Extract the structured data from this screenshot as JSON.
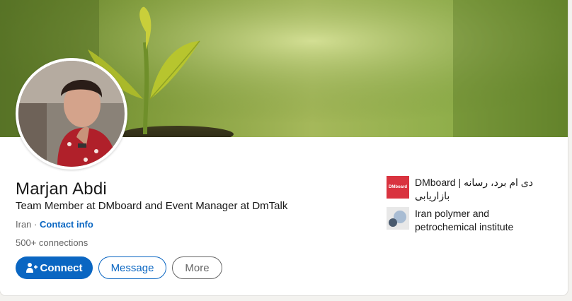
{
  "profile": {
    "name": "Marjan Abdi",
    "headline": "Team Member at DMboard and Event Manager at DmTalk",
    "location": "Iran",
    "separator": "·",
    "contact_info": "Contact info",
    "connections": "500+ connections"
  },
  "actions": {
    "connect": "Connect",
    "message": "Message",
    "more": "More"
  },
  "organizations": [
    {
      "name_line1": "DMboard | دی ام برد، رسانه",
      "name_line2": "بازاریابی",
      "logo_text": "DMboard",
      "logo_color": "#d9333f"
    },
    {
      "name": "Iran polymer and petrochemical institute",
      "logo_color": "#e8e8e8"
    }
  ],
  "colors": {
    "primary": "#0a66c2",
    "text": "#191919",
    "muted": "#666666"
  },
  "icons": {
    "connect": "add-person-icon",
    "banner": "sprout-photo",
    "avatar": "profile-photo"
  }
}
